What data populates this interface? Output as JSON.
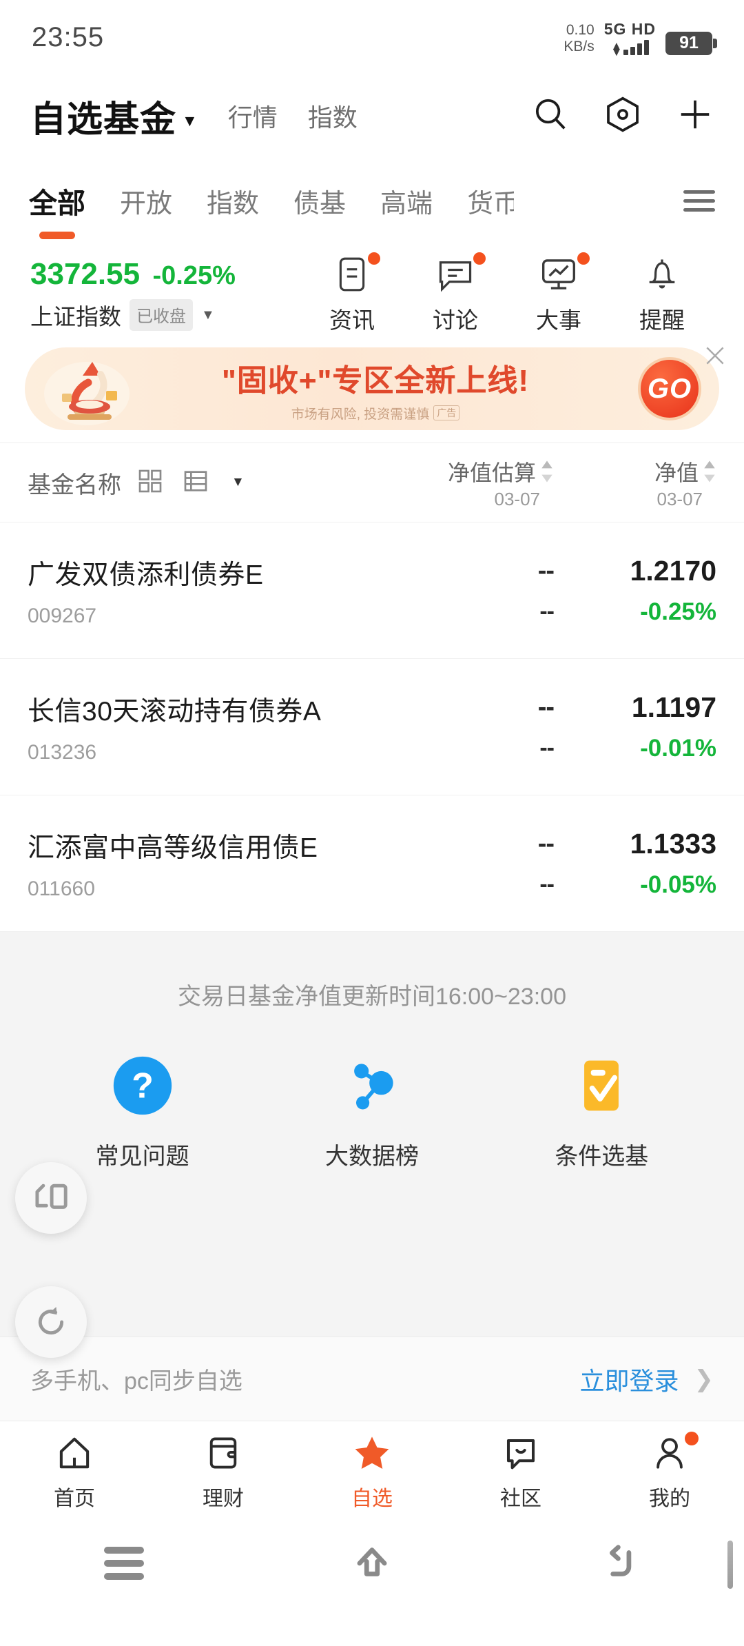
{
  "status_bar": {
    "time": "23:55",
    "net_speed_value": "0.10",
    "net_speed_unit": "KB/s",
    "network_type": "5G HD",
    "battery": "91"
  },
  "header": {
    "title": "自选基金",
    "caret": "▼",
    "nav_links": [
      "行情",
      "指数"
    ],
    "icons": [
      "search-icon",
      "hexagon-target-icon",
      "plus-icon"
    ]
  },
  "tabs": {
    "items": [
      {
        "label": "全部",
        "active": true
      },
      {
        "label": "开放",
        "active": false
      },
      {
        "label": "指数",
        "active": false
      },
      {
        "label": "债基",
        "active": false
      },
      {
        "label": "高端",
        "active": false
      },
      {
        "label": "货币",
        "active": false
      }
    ],
    "more_icon": "list-menu-icon",
    "accent": "#f05a28"
  },
  "index": {
    "value": "3372.55",
    "change_pct": "-0.25%",
    "name": "上证指数",
    "status_badge": "已收盘",
    "dropdown": "▼",
    "color": "#14b53a"
  },
  "quick_actions": [
    {
      "label": "资讯",
      "icon": "document-icon",
      "dot": true
    },
    {
      "label": "讨论",
      "icon": "chat-bubble-icon",
      "dot": true
    },
    {
      "label": "大事",
      "icon": "chart-monitor-icon",
      "dot": true
    },
    {
      "label": "提醒",
      "icon": "bell-icon",
      "dot": false
    }
  ],
  "banner": {
    "title": "\"固收+\"专区全新上线!",
    "subtitle": "市场有风险, 投资需谨慎",
    "ad_tag": "广告",
    "go_label": "GO",
    "close_icon": "close-icon"
  },
  "table": {
    "name_header": "基金名称",
    "view_grid_icon": "grid-view-icon",
    "view_list_icon": "list-view-icon",
    "view_caret": "▼",
    "columns": [
      {
        "label": "净值估算",
        "date": "03-07"
      },
      {
        "label": "净值",
        "date": "03-07"
      }
    ],
    "rows": [
      {
        "name": "广发双债添利债券E",
        "code": "009267",
        "estimate_value": "--",
        "estimate_pct": "--",
        "nav_value": "1.2170",
        "nav_pct": "-0.25%"
      },
      {
        "name": "长信30天滚动持有债券A",
        "code": "013236",
        "estimate_value": "--",
        "estimate_pct": "--",
        "nav_value": "1.1197",
        "nav_pct": "-0.01%"
      },
      {
        "name": "汇添富中高等级信用债E",
        "code": "011660",
        "estimate_value": "--",
        "estimate_pct": "--",
        "nav_value": "1.1333",
        "nav_pct": "-0.05%"
      }
    ]
  },
  "note": "交易日基金净值更新时间16:00~23:00",
  "features": [
    {
      "label": "常见问题",
      "icon": "question-circle-icon",
      "color": "#1b9cf0"
    },
    {
      "label": "大数据榜",
      "icon": "network-nodes-icon",
      "color": "#1b9cf0"
    },
    {
      "label": "条件选基",
      "icon": "checklist-icon",
      "color": "#fbb929"
    }
  ],
  "login_bar": {
    "text": "多手机、pc同步自选",
    "link": "立即登录",
    "chevron": "❯",
    "link_color": "#2a8fdc"
  },
  "bottom_nav": [
    {
      "label": "首页",
      "icon": "home-icon",
      "active": false,
      "dot": false
    },
    {
      "label": "理财",
      "icon": "wallet-icon",
      "active": false,
      "dot": false
    },
    {
      "label": "自选",
      "icon": "star-icon",
      "active": true,
      "dot": false
    },
    {
      "label": "社区",
      "icon": "community-chat-icon",
      "active": false,
      "dot": false
    },
    {
      "label": "我的",
      "icon": "person-icon",
      "active": false,
      "dot": true
    }
  ],
  "android_nav": {
    "recents_icon": "recents-menu-icon",
    "home_icon": "home-arrow-icon",
    "back_icon": "back-arrow-icon"
  },
  "floating_buttons": [
    {
      "icon": "split-screen-icon"
    },
    {
      "icon": "rotate-refresh-icon"
    }
  ]
}
